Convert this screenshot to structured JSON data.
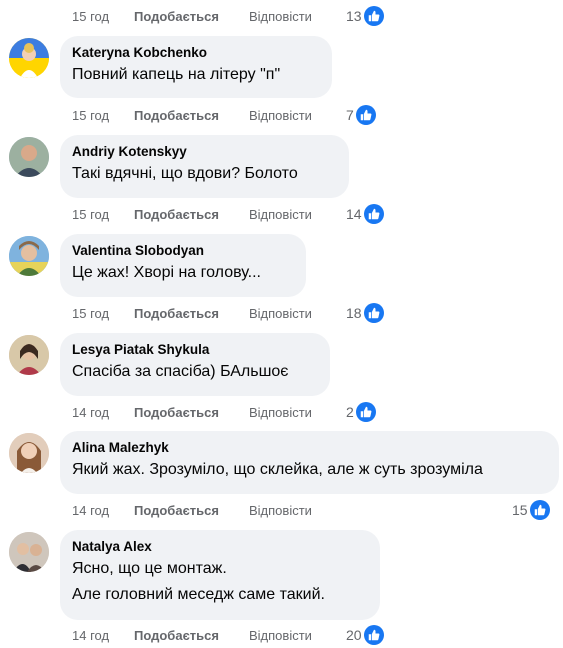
{
  "first_meta": {
    "time": "15 год",
    "like": "Подобається",
    "reply": "Відповісти",
    "count": "13"
  },
  "comments": [
    {
      "author": "Kateryna Kobchenko",
      "lines": [
        "Повний капець на літеру \"п\""
      ],
      "time": "15 год",
      "like": "Подобається",
      "reply": "Відповісти",
      "count": "7"
    },
    {
      "author": "Andriy Kotenskyy",
      "lines": [
        "Такі вдячні, що вдови? Болото"
      ],
      "time": "15 год",
      "like": "Подобається",
      "reply": "Відповісти",
      "count": "14"
    },
    {
      "author": "Valentina Slobodyan",
      "lines": [
        "Це жах! Хворі на голову..."
      ],
      "time": "15 год",
      "like": "Подобається",
      "reply": "Відповісти",
      "count": "18"
    },
    {
      "author": "Lesya Piatak Shykula",
      "lines": [
        "Спасіба за спасіба) БАльшоє"
      ],
      "time": "14 год",
      "like": "Подобається",
      "reply": "Відповісти",
      "count": "2"
    },
    {
      "author": "Alina Malezhyk",
      "lines": [
        "Який жах. Зрозуміло, що склейка, але ж суть зрозуміла"
      ],
      "time": "14 год",
      "like": "Подобається",
      "reply": "Відповісти",
      "count": "15"
    },
    {
      "author": "Natalya Alex",
      "lines": [
        "Ясно, що це монтаж.",
        "Але головний меседж саме такий."
      ],
      "time": "14 год",
      "like": "Подобається",
      "reply": "Відповісти",
      "count": "20"
    }
  ],
  "icons": {
    "like": "thumbs-up-icon",
    "avatar": "user-avatar"
  },
  "colors": {
    "like_blue": "#1877f2",
    "bubble": "#f0f2f5",
    "meta": "#65676b"
  }
}
